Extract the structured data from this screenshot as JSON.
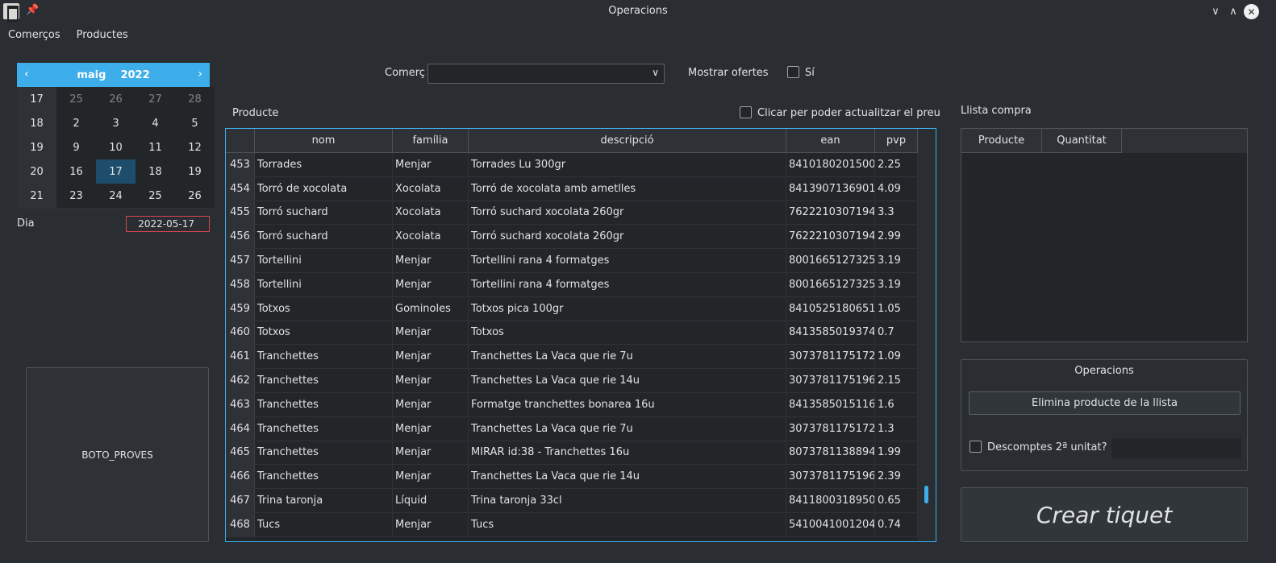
{
  "window": {
    "title": "Operacions"
  },
  "menu": [
    "Comerços",
    "Productes"
  ],
  "calendar": {
    "month": "maig",
    "year": "2022",
    "weeks": [
      {
        "week": "17",
        "days": [
          "25",
          "26",
          "27",
          "28"
        ],
        "other": [
          true,
          true,
          true,
          true
        ]
      },
      {
        "week": "18",
        "days": [
          "2",
          "3",
          "4",
          "5"
        ],
        "other": [
          false,
          false,
          false,
          false
        ]
      },
      {
        "week": "19",
        "days": [
          "9",
          "10",
          "11",
          "12"
        ],
        "other": [
          false,
          false,
          false,
          false
        ]
      },
      {
        "week": "20",
        "days": [
          "16",
          "17",
          "18",
          "19"
        ],
        "other": [
          false,
          false,
          false,
          false
        ]
      },
      {
        "week": "21",
        "days": [
          "23",
          "24",
          "25",
          "26"
        ],
        "other": [
          false,
          false,
          false,
          false
        ]
      }
    ],
    "selected_day": "17"
  },
  "dia": {
    "label": "Dia",
    "value": "2022-05-17"
  },
  "test_button": "BOTO_PROVES",
  "filters": {
    "comerc_label": "Comerç",
    "comerc_value": "",
    "ofertes_label": "Mostrar ofertes",
    "si_label": "Sí"
  },
  "producte": {
    "label": "Producte",
    "update_price_label": "Clicar per poder actualitzar el preu",
    "columns": [
      "nom",
      "família",
      "descripció",
      "ean",
      "pvp"
    ],
    "rows": [
      [
        "453",
        "Torrades",
        "Menjar",
        "Torrades Lu 300gr",
        "8410180201500",
        "2.25"
      ],
      [
        "454",
        "Torró de xocolata",
        "Xocolata",
        "Torró de xocolata amb ametlles",
        "8413907136901",
        "4.09"
      ],
      [
        "455",
        "Torró suchard",
        "Xocolata",
        "Torró suchard xocolata 260gr",
        "7622210307194",
        "3.3"
      ],
      [
        "456",
        "Torró suchard",
        "Xocolata",
        "Torró suchard xocolata 260gr",
        "7622210307194",
        "2.99"
      ],
      [
        "457",
        "Tortellini",
        "Menjar",
        "Tortellini rana 4 formatges",
        "8001665127325",
        "3.19"
      ],
      [
        "458",
        "Tortellini",
        "Menjar",
        "Tortellini rana 4 formatges",
        "8001665127325",
        "3.19"
      ],
      [
        "459",
        "Totxos",
        "Gominoles",
        "Totxos pica 100gr",
        "8410525180651",
        "1.05"
      ],
      [
        "460",
        "Totxos",
        "Menjar",
        "Totxos",
        "8413585019374",
        "0.7"
      ],
      [
        "461",
        "Tranchettes",
        "Menjar",
        "Tranchettes La Vaca que rie 7u",
        "3073781175172",
        "1.09"
      ],
      [
        "462",
        "Tranchettes",
        "Menjar",
        "Tranchettes La Vaca que rie 14u",
        "3073781175196",
        "2.15"
      ],
      [
        "463",
        "Tranchettes",
        "Menjar",
        "Formatge tranchettes bonarea 16u",
        "8413585015116",
        "1.6"
      ],
      [
        "464",
        "Tranchettes",
        "Menjar",
        "Tranchettes La Vaca que rie 7u",
        "3073781175172",
        "1.3"
      ],
      [
        "465",
        "Tranchettes",
        "Menjar",
        "MIRAR id:38 - Tranchettes 16u",
        "8073781138894",
        "1.99"
      ],
      [
        "466",
        "Tranchettes",
        "Menjar",
        "Tranchettes La Vaca que rie 14u",
        "3073781175196",
        "2.39"
      ],
      [
        "467",
        "Trina taronja",
        "Líquid",
        "Trina taronja 33cl",
        "8411800318950",
        "0.65"
      ],
      [
        "468",
        "Tucs",
        "Menjar",
        "Tucs",
        "5410041001204",
        "0.74"
      ]
    ]
  },
  "llista": {
    "label": "Llista compra",
    "columns": [
      "Producte",
      "Quantitat"
    ]
  },
  "operacions": {
    "title": "Operacions",
    "elimina_label": "Elimina producte de la llista",
    "descomptes_label": "Descomptes 2ª unitat?",
    "descomptes_value": ""
  },
  "crear_tiquet": "Crear tiquet",
  "colors": {
    "accent": "#3daee9",
    "background": "#2a2e32",
    "invalid_border": "#da4453"
  }
}
